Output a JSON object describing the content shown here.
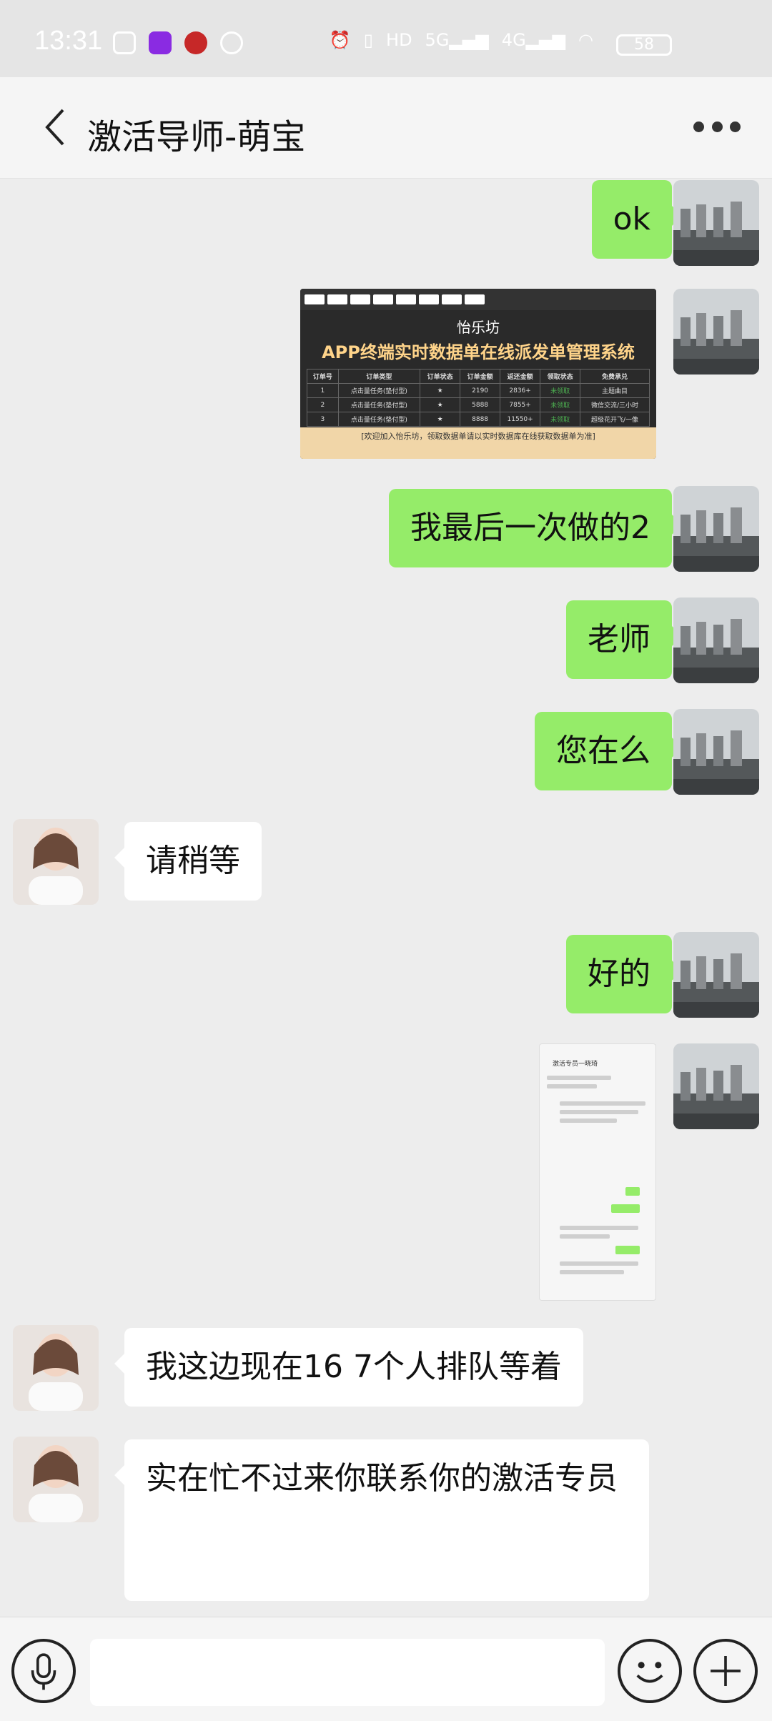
{
  "status_bar": {
    "time": "13:31",
    "battery": "58"
  },
  "header": {
    "title": "激活导师-萌宝"
  },
  "messages": [
    {
      "sender": "me",
      "type": "text",
      "text": "ok"
    },
    {
      "sender": "me",
      "type": "image",
      "brand": "怡乐坊",
      "headline": "APP终端实时数据单在线派发单管理系统",
      "table_header": [
        "订单号",
        "订单类型",
        "订单状态",
        "订单金额",
        "返还金额",
        "领取状态",
        "免费承兑"
      ],
      "rows": [
        [
          "1",
          "点击量任务(垫付型)",
          "★",
          "2190",
          "2836+",
          "未领取",
          "主题曲目"
        ],
        [
          "2",
          "点击量任务(垫付型)",
          "★",
          "5888",
          "7855+",
          "未领取",
          "微信交流/三小时"
        ],
        [
          "3",
          "点击量任务(垫付型)",
          "★",
          "8888",
          "11550+",
          "未领取",
          "超级花开飞/一像"
        ]
      ],
      "footer": "[欢迎加入怡乐坊，领取数据单请以实时数据库在线获取数据单为准]"
    },
    {
      "sender": "me",
      "type": "text",
      "text": "我最后一次做的2"
    },
    {
      "sender": "me",
      "type": "text",
      "text": "老师"
    },
    {
      "sender": "me",
      "type": "text",
      "text": "您在么"
    },
    {
      "sender": "other",
      "type": "text",
      "text": "请稍等"
    },
    {
      "sender": "me",
      "type": "text",
      "text": "好的"
    },
    {
      "sender": "me",
      "type": "screenshot",
      "caption": "激活专员一晓琦"
    },
    {
      "sender": "other",
      "type": "text",
      "text": "我这边现在16 7个人排队等着"
    },
    {
      "sender": "other",
      "type": "text",
      "text": "实在忙不过来你联系你的激活专员"
    }
  ],
  "icons": {
    "back": "chevron-left-icon",
    "more": "more-dots-icon",
    "voice": "microphone-icon",
    "emoji": "emoji-icon",
    "plus": "plus-icon"
  },
  "colors": {
    "my_bubble": "#95ec69",
    "other_bubble": "#ffffff",
    "background": "#ededed"
  }
}
